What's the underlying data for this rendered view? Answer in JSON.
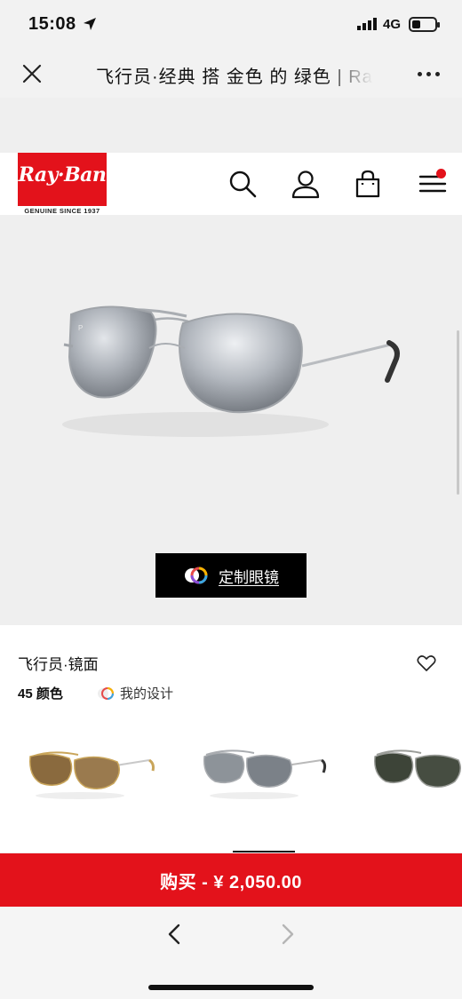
{
  "status_bar": {
    "time": "15:08",
    "network": "4G"
  },
  "browser": {
    "title": "飞行员·经典 搭 金色 的 绿色 | Ray-Ban"
  },
  "site": {
    "logo_text": "Ray·Ban",
    "logo_subtitle": "GENUINE SINCE 1937",
    "brand_color": "#e3121b"
  },
  "hero": {
    "customize_label": "定制眼镜"
  },
  "product": {
    "name": "飞行员·镜面",
    "colors_count": "45 颜色",
    "my_design_label": "我的设计",
    "color_variants": [
      {
        "name": "gold-brown-variant",
        "lens": "#8a6a3e",
        "frame": "#c9a55a"
      },
      {
        "name": "silver-mirror-variant",
        "lens": "#6f757c",
        "frame": "#a9acb0"
      },
      {
        "name": "green-variant",
        "lens": "#3d4438",
        "frame": "#9b9d99"
      }
    ]
  },
  "buy_bar": {
    "label": "购买 - ¥ 2,050.00"
  },
  "icons": [
    "location-arrow-icon",
    "signal-icon",
    "battery-icon",
    "close-icon",
    "more-icon",
    "search-icon",
    "account-icon",
    "shopping-bag-icon",
    "menu-icon",
    "heart-icon",
    "color-wheel-icon",
    "back-arrow-icon",
    "forward-arrow-icon"
  ]
}
